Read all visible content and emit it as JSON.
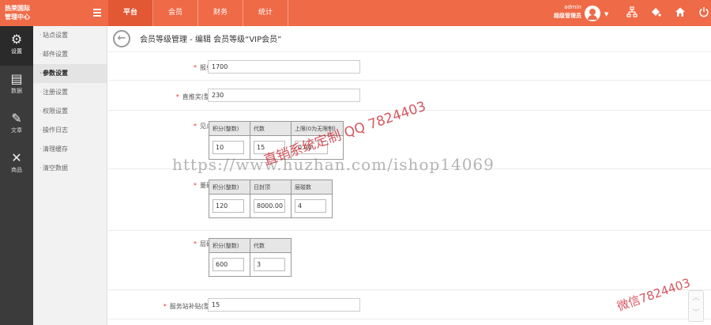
{
  "brand": {
    "line1": "热荣国际",
    "line2": "管理中心"
  },
  "topnav": {
    "tabs": [
      {
        "label": "平台",
        "active": true
      },
      {
        "label": "会员",
        "active": false
      },
      {
        "label": "财务",
        "active": false
      },
      {
        "label": "统计",
        "active": false
      }
    ]
  },
  "user": {
    "name": "admin",
    "role": "超级管理员"
  },
  "top_icons": [
    "sitemap-icon",
    "paint-bucket-icon",
    "home-icon",
    "power-icon"
  ],
  "sidebar": [
    {
      "label": "设置",
      "icon": "gear-icon",
      "active": true
    },
    {
      "label": "数据",
      "icon": "data-icon",
      "active": false
    },
    {
      "label": "文章",
      "icon": "article-icon",
      "active": false
    },
    {
      "label": "商品",
      "icon": "tools-icon",
      "active": false
    }
  ],
  "submenu": [
    {
      "label": "站点设置",
      "active": false
    },
    {
      "label": "邮件设置",
      "active": false
    },
    {
      "label": "参数设置",
      "active": true
    },
    {
      "label": "注册设置",
      "active": false
    },
    {
      "label": "权限设置",
      "active": false
    },
    {
      "label": "操作日志",
      "active": false
    },
    {
      "label": "清理缓存",
      "active": false
    },
    {
      "label": "清空数据",
      "active": false
    }
  ],
  "page": {
    "title": "会员等级管理 - 编辑 会员等级“VIP会员”"
  },
  "form": {
    "report_fee": {
      "label": "报单费",
      "value": "1700"
    },
    "direct_bonus": {
      "label": "直推奖(整数)",
      "value": "230"
    },
    "touch_bonus": {
      "label": "见点奖",
      "headers": [
        "积分(整数)",
        "代数",
        "上限(0为无限制)"
      ],
      "values": [
        "10",
        "15",
        "0.00"
      ]
    },
    "volume_bonus": {
      "label": "量碰奖",
      "headers": [
        "积分(整数)",
        "日封顶",
        "层碰数"
      ],
      "values": [
        "120",
        "8000.00",
        "4"
      ]
    },
    "layer_bonus": {
      "label": "层碰奖",
      "headers": [
        "积分(整数)",
        "代数"
      ],
      "values": [
        "600",
        "3"
      ]
    },
    "service_subsidy": {
      "label": "服务站补贴(整数)",
      "value": "15"
    }
  },
  "watermarks": {
    "url": "https://www.huzhan.com/ishop14069",
    "qq": "直销系统定制 QQ 7824403",
    "wechat": "微信7824403"
  },
  "colors": {
    "accent": "#ef6a47",
    "active_tab": "#e25734",
    "sidebar": "#3b3b3b",
    "required": "#e33333"
  }
}
